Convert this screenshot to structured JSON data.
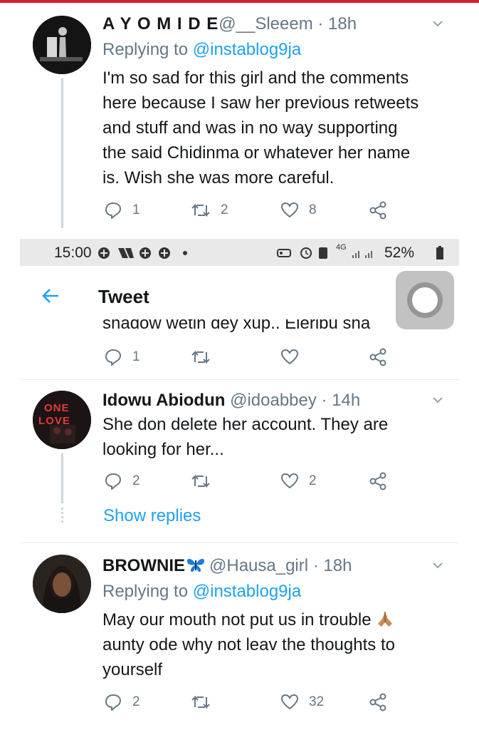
{
  "tweets": [
    {
      "name": "A Y O M I D E",
      "handle": "@__Sleeem",
      "time": "· 18h",
      "replying_label": "Replying to",
      "replying_to": "@instablog9ja",
      "lines": [
        "I'm so sad for this girl and the comments",
        "here because I saw her previous retweets",
        "and stuff and was in no way supporting",
        "the said Chidinma or whatever her name",
        "is. Wish she was more careful."
      ],
      "replies": "1",
      "retweets": "2",
      "likes": "8"
    },
    {
      "name": "Idowu Abiodun",
      "handle": "@idoabbey",
      "time": "· 14h",
      "lines": [
        "She don delete her account. They are",
        "looking for her..."
      ],
      "replies": "2",
      "retweets": "",
      "likes": "2",
      "show_replies": "Show replies",
      "avatar_text": [
        "ONE",
        "LOVE"
      ]
    },
    {
      "name": "BROWNIE",
      "handle": "@Hausa_girl",
      "time": "· 18h",
      "replying_label": "Replying to",
      "replying_to": "@instablog9ja",
      "lines": [
        "May our mouth not put us in trouble",
        "aunty ode why not leav the thoughts to",
        "yourself"
      ],
      "replies": "2",
      "retweets": "",
      "likes": "32"
    }
  ],
  "partial_tweet": {
    "clipped_text": "shadow wetin dey xup.. Eleribu sha",
    "replies": "1"
  },
  "status_bar": {
    "time": "15:00",
    "network": "4G",
    "battery": "52%"
  },
  "nav": {
    "title": "Tweet"
  },
  "colors": {
    "accent": "#1da1f2",
    "muted": "#657786",
    "text": "#14171a"
  }
}
